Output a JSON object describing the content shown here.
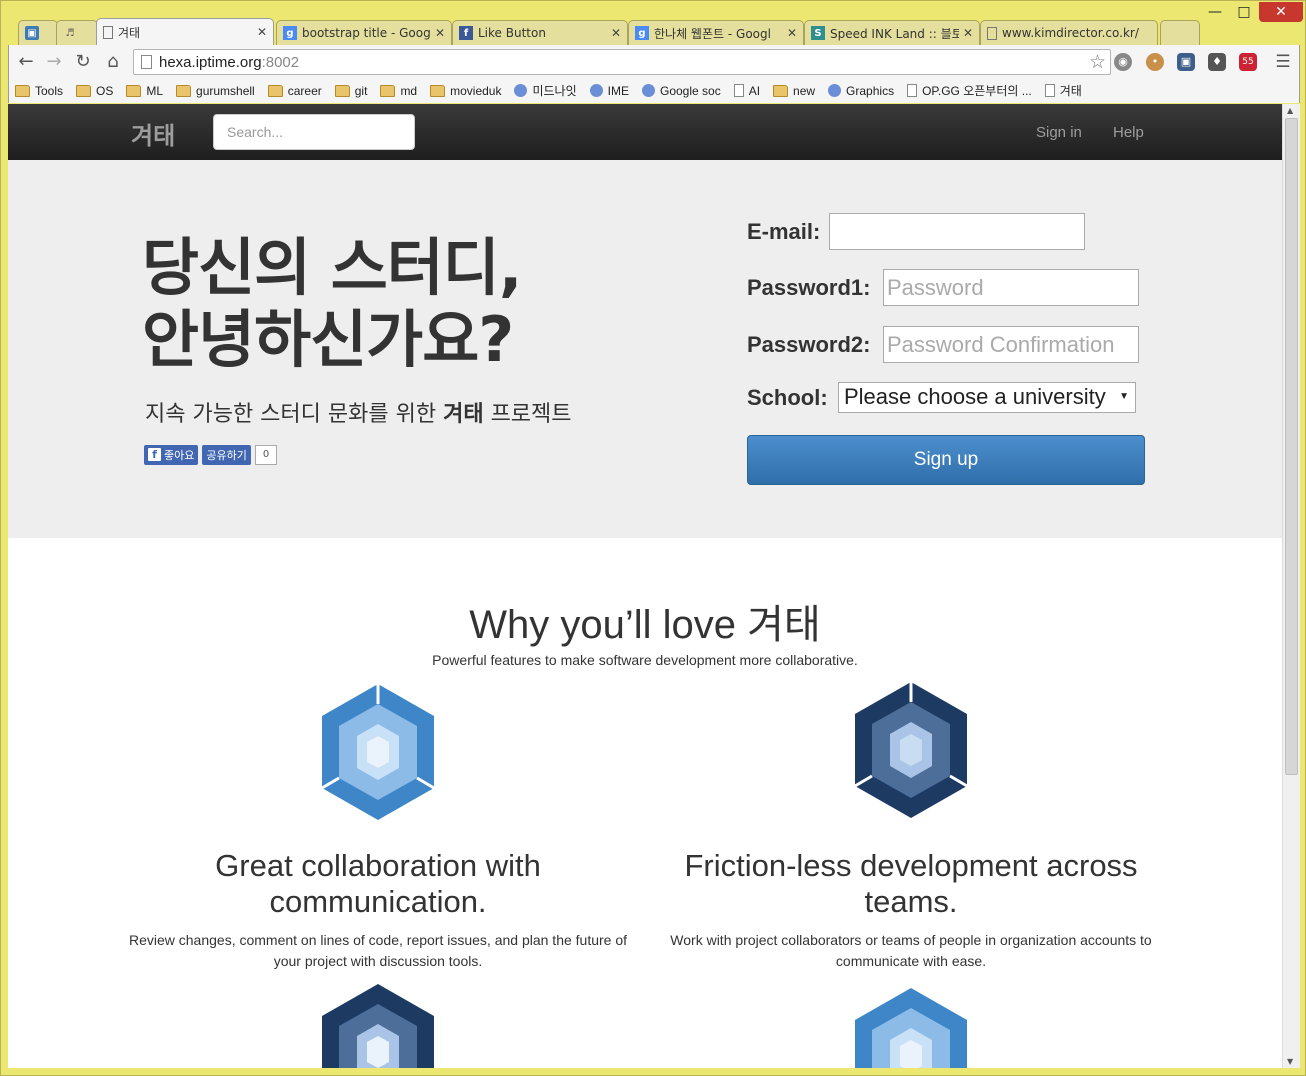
{
  "browser": {
    "tabs": [
      {
        "title": "",
        "icon": "trello-icon"
      },
      {
        "title": "",
        "icon": "speaker-icon"
      },
      {
        "title": "겨태",
        "icon": "page-icon"
      },
      {
        "title": "bootstrap title - Google",
        "icon": "google-icon"
      },
      {
        "title": "Like Button",
        "icon": "facebook-icon"
      },
      {
        "title": "한나체 웹폰트 - Googl",
        "icon": "google-icon"
      },
      {
        "title": "Speed INK Land :: 블토",
        "icon": "site-icon"
      },
      {
        "title": "www.kimdirector.co.kr/",
        "icon": "page-icon"
      }
    ],
    "url_host": "hexa.iptime.org",
    "url_port": ":8002",
    "bookmarks": [
      {
        "label": "Tools",
        "type": "folder"
      },
      {
        "label": "OS",
        "type": "folder"
      },
      {
        "label": "ML",
        "type": "folder"
      },
      {
        "label": "gurumshell",
        "type": "folder"
      },
      {
        "label": "career",
        "type": "folder"
      },
      {
        "label": "git",
        "type": "folder"
      },
      {
        "label": "md",
        "type": "folder"
      },
      {
        "label": "movieduk",
        "type": "folder"
      },
      {
        "label": "미드나잇",
        "type": "site"
      },
      {
        "label": "IME",
        "type": "site"
      },
      {
        "label": "Google soc",
        "type": "site"
      },
      {
        "label": "AI",
        "type": "page"
      },
      {
        "label": "new",
        "type": "folder"
      },
      {
        "label": "Graphics",
        "type": "site"
      },
      {
        "label": "OP.GG 오픈부터의 ...",
        "type": "page"
      },
      {
        "label": "겨태",
        "type": "page"
      }
    ],
    "ext_badge": "55"
  },
  "site": {
    "brand": "겨태",
    "search_placeholder": "Search...",
    "nav": {
      "signin": "Sign in",
      "help": "Help"
    }
  },
  "hero": {
    "headline_line1": "당신의 스터디,",
    "headline_line2": "안녕하신가요?",
    "sub_pre": "지속 가능한 스터디 문화를 위한 ",
    "sub_bold": "겨태",
    "sub_post": " 프로젝트",
    "fb_like": "좋아요",
    "fb_share": "공유하기",
    "fb_count": "0"
  },
  "form": {
    "email_label": "E-mail:",
    "email_value": "",
    "password1_label": "Password1:",
    "password1_placeholder": "Password",
    "password2_label": "Password2:",
    "password2_placeholder": "Password Confirmation",
    "school_label": "School:",
    "school_selected": "Please choose a university",
    "signup_label": "Sign up"
  },
  "features": {
    "title": "Why you’ll love 겨태",
    "subtitle": "Powerful features to make software development more collaborative.",
    "items": [
      {
        "title": "Great collaboration with communication.",
        "desc": "Review changes, comment on lines of code, report issues, and plan the future of your project with discussion tools."
      },
      {
        "title": "Friction-less development across teams.",
        "desc": "Work with project collaborators or teams of people in organization accounts to communicate with ease."
      }
    ]
  },
  "colors": {
    "hex_light": [
      "#3e86c8",
      "#8cbbe8",
      "#c9e1f7"
    ],
    "hex_dark": [
      "#1d3a63",
      "#4e6e9a",
      "#a9c4e6"
    ],
    "navbar": "#222222",
    "button": "#337ab7"
  }
}
